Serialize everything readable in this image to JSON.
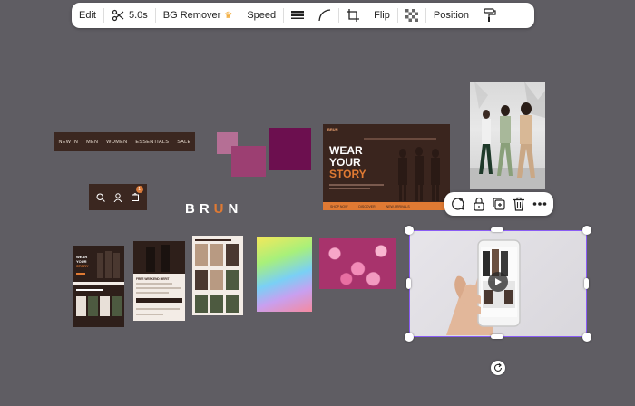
{
  "toolbar": {
    "edit": "Edit",
    "duration": "5.0s",
    "bg_remover": "BG Remover",
    "speed": "Speed",
    "flip": "Flip",
    "position": "Position"
  },
  "navbar": {
    "items": [
      "NEW IN",
      "MEN",
      "WOMEN",
      "ESSENTIALS",
      "SALE"
    ]
  },
  "iconbar": {
    "cart_count": "1"
  },
  "logo": {
    "part1": "BR",
    "part2": "U",
    "part3": "N"
  },
  "hero": {
    "brand": "BRUN",
    "line1": "WEAR",
    "line2": "YOUR",
    "line3": "STORY",
    "btn1": "SHOP NOW",
    "btn2": "DISCOVER",
    "btn3": "NEW ARRIVALS"
  },
  "mockB": {
    "title": "FREE WEEKEND MERIT"
  },
  "colors": {
    "accent": "#e07a33",
    "brown": "#3a251e",
    "selection": "#8a5cf5"
  }
}
